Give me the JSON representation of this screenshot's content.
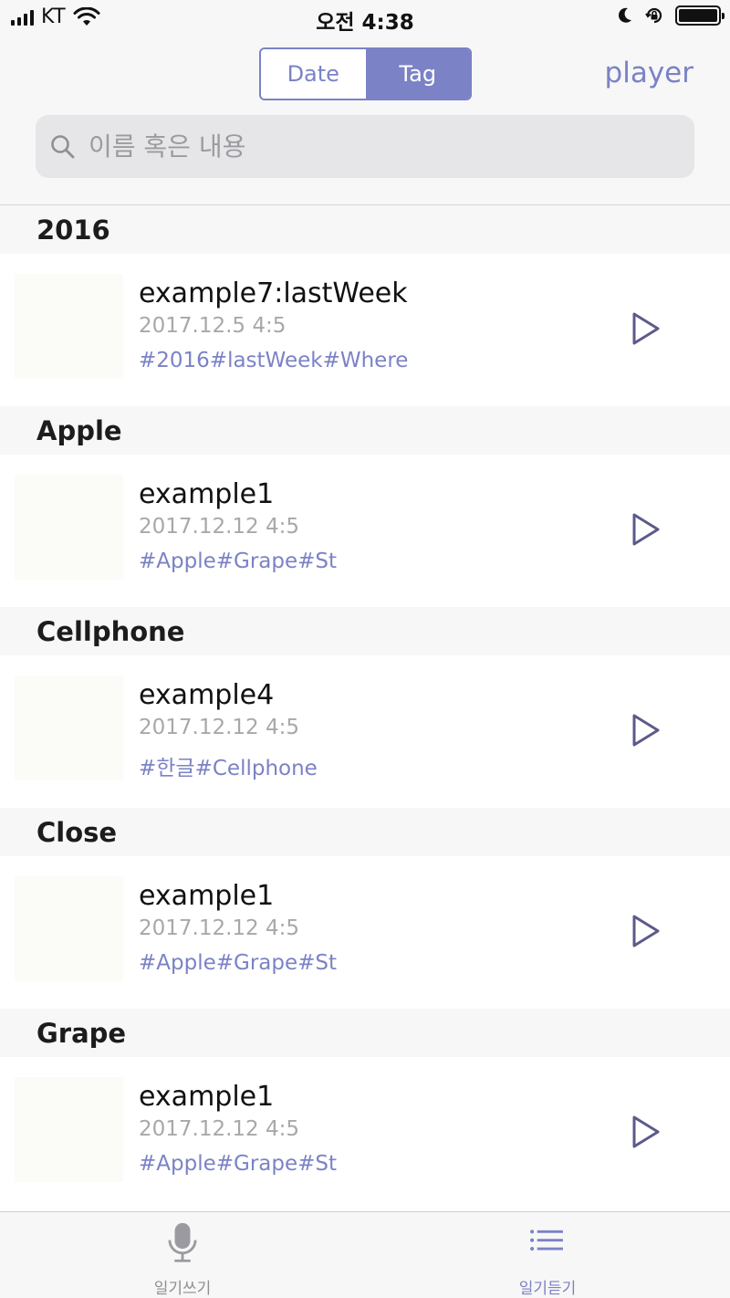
{
  "status_bar": {
    "carrier": "KT",
    "time": "오전 4:38"
  },
  "header": {
    "segments": [
      {
        "label": "Date",
        "selected": false
      },
      {
        "label": "Tag",
        "selected": true
      }
    ],
    "player_label": "player",
    "search": {
      "placeholder": "이름 혹은 내용",
      "value": ""
    }
  },
  "sections": [
    {
      "title": "2016",
      "items": [
        {
          "title": "example7:lastWeek",
          "date": "2017.12.5 4:5",
          "tags": "#2016#lastWeek#Where"
        }
      ]
    },
    {
      "title": "Apple",
      "items": [
        {
          "title": "example1",
          "date": "2017.12.12 4:5",
          "tags": "#Apple#Grape#St"
        }
      ]
    },
    {
      "title": "Cellphone",
      "items": [
        {
          "title": "example4",
          "date": "2017.12.12 4:5",
          "tags": "#한글#Cellphone"
        }
      ]
    },
    {
      "title": "Close",
      "items": [
        {
          "title": "example1",
          "date": "2017.12.12 4:5",
          "tags": "#Apple#Grape#St"
        }
      ]
    },
    {
      "title": "Grape",
      "items": [
        {
          "title": "example1",
          "date": "2017.12.12 4:5",
          "tags": "#Apple#Grape#St"
        }
      ]
    }
  ],
  "tab_bar": {
    "tabs": [
      {
        "label": "일기쓰기",
        "icon": "microphone-icon",
        "active": false
      },
      {
        "label": "일기듣기",
        "icon": "list-icon",
        "active": true
      }
    ]
  },
  "colors": {
    "accent": "#7b82c6",
    "play_icon": "#5c5a8a",
    "secondary_text": "#a8a8a8",
    "section_background": "#f7f7f7"
  }
}
